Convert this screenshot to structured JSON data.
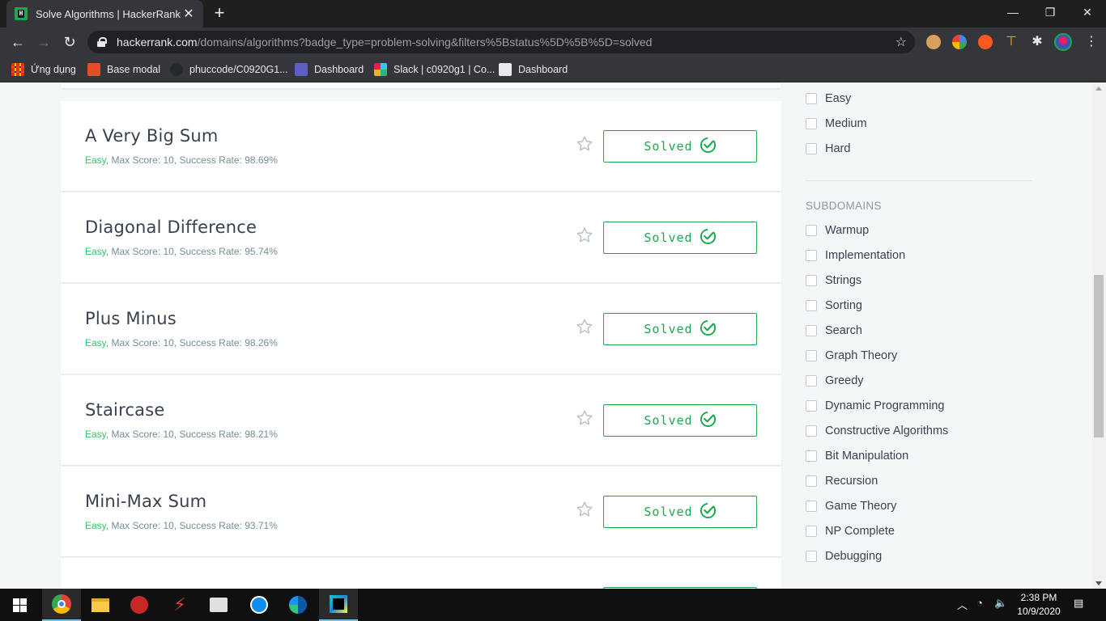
{
  "browser": {
    "tab_title": "Solve Algorithms | HackerRank",
    "tab_favicon": "H",
    "url_host": "hackerrank.com",
    "url_path": "/domains/algorithms?badge_type=problem-solving&filters%5Bstatus%5D%5B%5D=solved",
    "bookmarks": [
      "Ứng dụng",
      "Base modal",
      "phuccode/C0920G1...",
      "Dashboard",
      "Slack | c0920g1 | Co...",
      "Dashboard"
    ]
  },
  "challenges": [
    {
      "title": "A Very Big Sum",
      "difficulty": "Easy",
      "meta": ", Max Score: 10, Success Rate: 98.69%",
      "status": "Solved"
    },
    {
      "title": "Diagonal Difference",
      "difficulty": "Easy",
      "meta": ", Max Score: 10, Success Rate: 95.74%",
      "status": "Solved"
    },
    {
      "title": "Plus Minus",
      "difficulty": "Easy",
      "meta": ", Max Score: 10, Success Rate: 98.26%",
      "status": "Solved"
    },
    {
      "title": "Staircase",
      "difficulty": "Easy",
      "meta": ", Max Score: 10, Success Rate: 98.21%",
      "status": "Solved"
    },
    {
      "title": "Mini-Max Sum",
      "difficulty": "Easy",
      "meta": ", Max Score: 10, Success Rate: 93.71%",
      "status": "Solved"
    }
  ],
  "difficulty_filters": [
    "Easy",
    "Medium",
    "Hard"
  ],
  "subdomains": {
    "heading": "SUBDOMAINS",
    "items": [
      "Warmup",
      "Implementation",
      "Strings",
      "Sorting",
      "Search",
      "Graph Theory",
      "Greedy",
      "Dynamic Programming",
      "Constructive Algorithms",
      "Bit Manipulation",
      "Recursion",
      "Game Theory",
      "NP Complete",
      "Debugging"
    ]
  },
  "taskbar": {
    "time": "2:38 PM",
    "date": "10/9/2020"
  },
  "colors": {
    "accent_green": "#1ba94c",
    "easy_green": "#2ec866",
    "text_dark": "#39424e"
  }
}
